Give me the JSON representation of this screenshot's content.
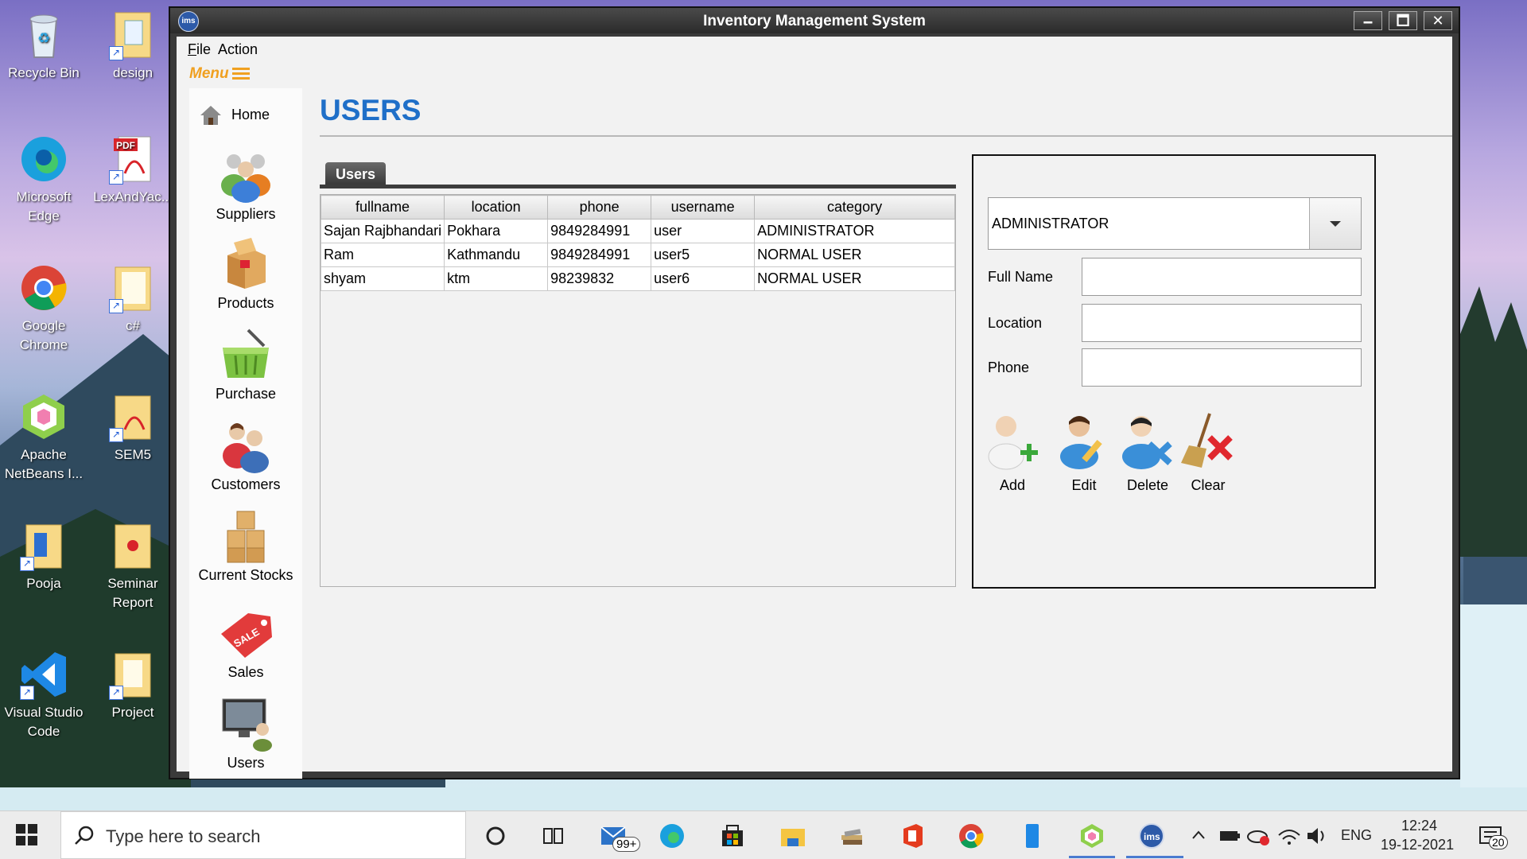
{
  "desktop": {
    "icons": [
      {
        "label": "Recycle Bin"
      },
      {
        "label": "design"
      },
      {
        "label": "Microsoft Edge"
      },
      {
        "label": "LexAndYac..."
      },
      {
        "label": "Google Chrome"
      },
      {
        "label": "c#"
      },
      {
        "label": "Apache NetBeans I..."
      },
      {
        "label": "SEM5"
      },
      {
        "label": "Pooja"
      },
      {
        "label": "Seminar Report"
      },
      {
        "label": "Visual Studio Code"
      },
      {
        "label": "Project"
      }
    ],
    "pdf_badge": "PDF"
  },
  "window": {
    "title": "Inventory Management System",
    "logo_text": "ims",
    "controls": {
      "minimize": "🗕",
      "maximize": "🗖",
      "close": "✕"
    }
  },
  "menubar": {
    "file": "File",
    "action": "Action",
    "menu_toggle": "Menu"
  },
  "sidebar": {
    "items": [
      {
        "label": "Home",
        "icon": "home-icon"
      },
      {
        "label": "Suppliers",
        "icon": "suppliers-icon"
      },
      {
        "label": "Products",
        "icon": "products-icon"
      },
      {
        "label": "Purchase",
        "icon": "purchase-basket-icon"
      },
      {
        "label": "Customers",
        "icon": "customers-icon"
      },
      {
        "label": "Current Stocks",
        "icon": "stock-boxes-icon"
      },
      {
        "label": "Sales",
        "icon": "sale-tag-icon"
      },
      {
        "label": "Users",
        "icon": "users-computer-icon"
      }
    ],
    "sale_tag_text": "SALE"
  },
  "main": {
    "title": "USERS",
    "tab": "Users",
    "table": {
      "columns": [
        "fullname",
        "location",
        "phone",
        "username",
        "category"
      ],
      "rows": [
        [
          "Sajan Rajbhandari",
          "Pokhara",
          "9849284991",
          "user",
          "ADMINISTRATOR"
        ],
        [
          "Ram",
          "Kathmandu",
          "9849284991",
          "user5",
          "NORMAL USER"
        ],
        [
          "shyam",
          "ktm",
          "98239832",
          "user6",
          "NORMAL USER"
        ]
      ]
    }
  },
  "form": {
    "category_selected": "ADMINISTRATOR",
    "fields": {
      "full_name": "Full Name",
      "location": "Location",
      "phone": "Phone"
    },
    "values": {
      "full_name": "",
      "location": "",
      "phone": ""
    },
    "actions": {
      "add": "Add",
      "edit": "Edit",
      "delete": "Delete",
      "clear": "Clear"
    }
  },
  "taskbar": {
    "search_placeholder": "Type here to search",
    "mail_badge": "99+",
    "language": "ENG",
    "time": "12:24",
    "date": "19-12-2021",
    "notification_count": "20"
  },
  "colors": {
    "accent_title": "#1f6fc8",
    "menu_orange": "#f0a020",
    "window_frame": "#3a3a3a"
  }
}
